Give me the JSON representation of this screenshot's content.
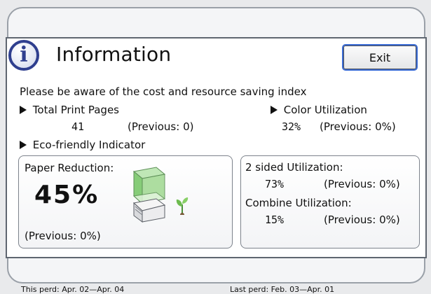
{
  "window": {
    "title": "Information",
    "exit_label": "Exit",
    "background_hint": "Select"
  },
  "notice": "Please be aware of the cost and resource saving index",
  "stats": {
    "total_print_pages": {
      "label": "Total Print Pages",
      "value": "41",
      "previous": "(Previous: 0)"
    },
    "color_utilization": {
      "label": "Color Utilization",
      "value": "32%",
      "previous": "(Previous: 0%)"
    }
  },
  "eco": {
    "label": "Eco-friendly Indicator",
    "paper_reduction": {
      "label": "Paper Reduction:",
      "value": "45%",
      "previous": "(Previous: 0%)"
    },
    "two_sided": {
      "label": "2 sided Utilization:",
      "value": "73%",
      "previous": "(Previous: 0%)"
    },
    "combine": {
      "label": "Combine Utilization:",
      "value": "15%",
      "previous": "(Previous: 0%)"
    }
  },
  "periods": {
    "this_period": "This perd: Apr. 02—Apr. 04",
    "last_period": "Last perd: Feb. 03—Apr. 01"
  },
  "colors": {
    "accent": "#2f3f8f",
    "selection_outline": "#3a6bd4",
    "paper_green": "#7ac46a"
  },
  "icons": {
    "info": "info-icon",
    "paper": "paper-stack-icon",
    "plant": "sprout-icon"
  }
}
